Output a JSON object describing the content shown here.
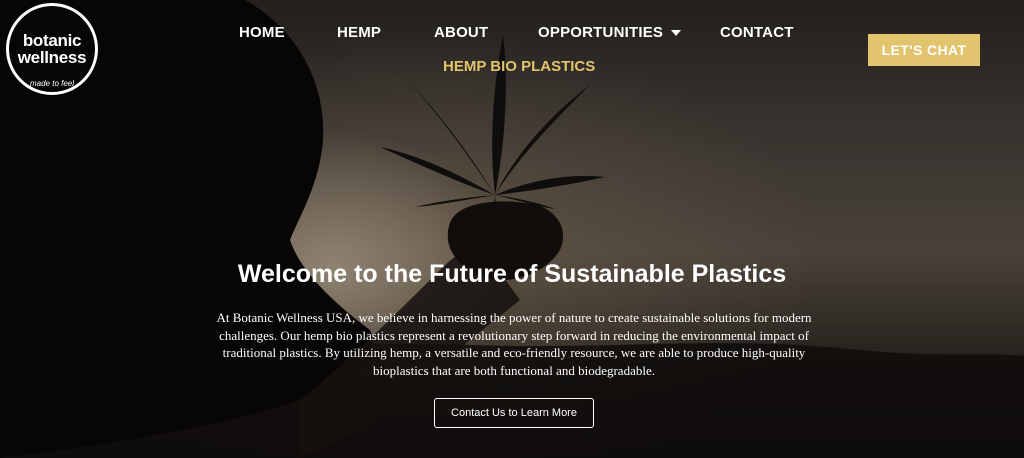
{
  "logo": {
    "line1": "botanic",
    "line2": "wellness",
    "tagline": "made to feel"
  },
  "nav": {
    "items": [
      "HOME",
      "HEMP",
      "ABOUT",
      "OPPORTUNITIES",
      "CONTACT"
    ],
    "active_sub": "HEMP BIO PLASTICS",
    "cta": "LET'S CHAT"
  },
  "hero": {
    "title": "Welcome to the Future of Sustainable Plastics",
    "description": "At Botanic Wellness USA, we believe in harnessing the power of nature to create sustainable solutions for modern challenges. Our hemp bio plastics represent a revolutionary step forward in reducing the environmental impact of traditional plastics. By utilizing hemp, a versatile and eco-friendly resource, we are able to produce high-quality bioplastics that are both functional and biodegradable.",
    "button": "Contact Us to Learn More"
  },
  "colors": {
    "accent": "#e1c46d",
    "accent_text": "#e2c46c"
  },
  "icons": {
    "dropdown": "chevron-down-icon"
  }
}
